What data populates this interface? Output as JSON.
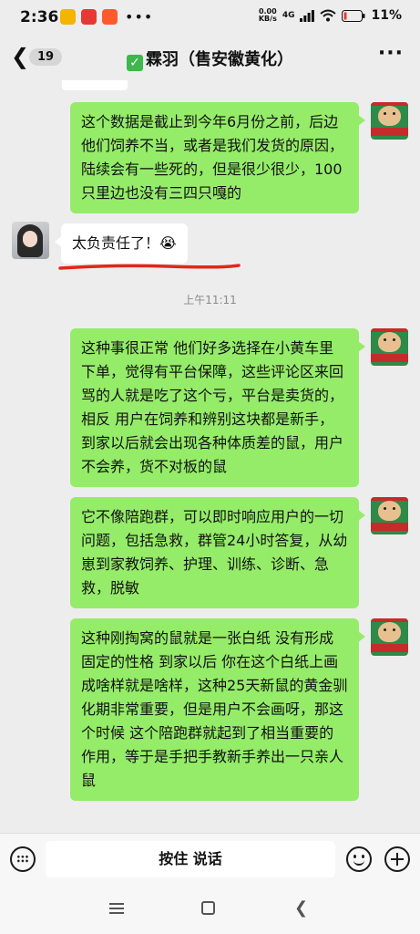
{
  "status_bar": {
    "time": "2:36",
    "net_speed_top": "0.00",
    "net_speed_bottom": "KB/s",
    "network": "4G",
    "battery": "11%"
  },
  "header": {
    "back_icon": "chevron-left-icon",
    "unread_count": "19",
    "title_mark": "✓",
    "title": "霖羽（售安徽黄化）",
    "more_icon": "more-dots-icon"
  },
  "messages": [
    {
      "side": "me",
      "text": "这个数据是截止到今年6月份之前，后边他们饲养不当，或者是我们发货的原因，陆续会有一些死的，但是很少很少，100只里边也没有三四只嘎的"
    },
    {
      "side": "other",
      "text": "太负责任了！😭"
    },
    {
      "side": "time",
      "text": "上午11:11"
    },
    {
      "side": "me",
      "text": "这种事很正常 他们好多选择在小黄车里下单，觉得有平台保障，这些评论区来回骂的人就是吃了这个亏，平台是卖货的，相反 用户在饲养和辨别这块都是新手，到家以后就会出现各种体质差的鼠，用户不会养，货不对板的鼠"
    },
    {
      "side": "me",
      "text": "它不像陪跑群，可以即时响应用户的一切问题，包括急救，群管24小时答复，从幼崽到家教饲养、护理、训练、诊断、急救，脱敏"
    },
    {
      "side": "me",
      "text": "这种刚掏窝的鼠就是一张白纸 没有形成固定的性格 到家以后 你在这个白纸上画成啥样就是啥样，这种25天新鼠的黄金驯化期非常重要，但是用户不会画呀，那这个时候 这个陪跑群就起到了相当重要的作用，等于是手把手教新手养出一只亲人鼠"
    }
  ],
  "input_bar": {
    "voice_label": "按住 说话",
    "keyboard_icon": "keyboard-icon",
    "emoji_icon": "emoji-icon",
    "plus_icon": "plus-icon"
  },
  "colors": {
    "my_bubble": "#95ec69",
    "other_bubble": "#ffffff",
    "background": "#ededed",
    "annotation_underline": "#e0271b"
  }
}
